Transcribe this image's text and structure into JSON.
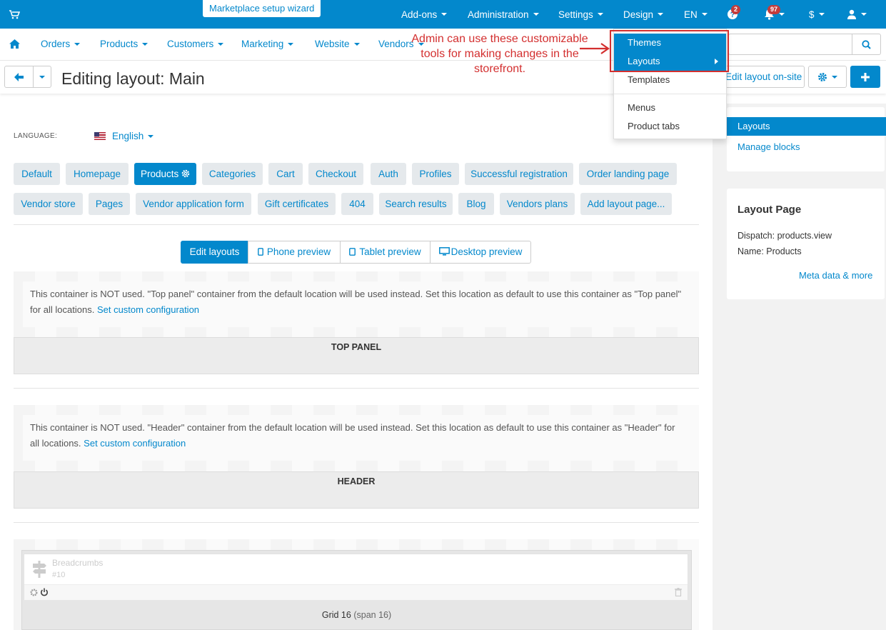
{
  "topbar": {
    "wizard": "Marketplace setup wizard",
    "items": [
      "Add-ons",
      "Administration",
      "Settings",
      "Design",
      "EN",
      "$"
    ],
    "help_badge": "2",
    "notif_badge": "97"
  },
  "nav2": {
    "items": [
      "Orders",
      "Products",
      "Customers",
      "Marketing",
      "Website",
      "Vendors"
    ]
  },
  "toolbar": {
    "title": "Editing layout: Main",
    "edit_onsite": "Edit layout on-site"
  },
  "language": {
    "label": "LANGUAGE:",
    "value": "English"
  },
  "tabs_row1": [
    "Default",
    "Homepage",
    "Products",
    "Categories",
    "Cart",
    "Checkout",
    "Auth",
    "Profiles",
    "Successful registration",
    "Order landing page"
  ],
  "tabs_row2": [
    "Vendor store",
    "Pages",
    "Vendor application form",
    "Gift certificates",
    "404",
    "Search results",
    "Blog",
    "Vendors plans",
    "Add layout page..."
  ],
  "view_buttons": [
    "Edit layouts",
    "Phone preview",
    "Tablet preview",
    "Desktop preview"
  ],
  "containers": {
    "top_panel": {
      "notice": "This container is NOT used. \"Top panel\" container from the default location will be used instead. Set this location as default to use this container as \"Top panel\" for all locations.",
      "link": "Set custom configuration",
      "label": "TOP PANEL"
    },
    "header": {
      "notice": "This container is NOT used. \"Header\" container from the default location will be used instead. Set this location as default to use this container as \"Header\" for all locations.",
      "link": "Set custom configuration",
      "label": "HEADER"
    }
  },
  "block": {
    "name": "Breadcrumbs",
    "id": "#10",
    "grid": "Grid 16",
    "span": "(span 16)"
  },
  "sidebar": {
    "nav": [
      "Layouts",
      "Manage blocks"
    ],
    "panel_title": "Layout Page",
    "dispatch": "Dispatch: products.view",
    "name": "Name: Products",
    "meta_link": "Meta data & more"
  },
  "dropdown": {
    "items": [
      "Themes",
      "Layouts",
      "Templates",
      "Menus",
      "Product tabs"
    ]
  },
  "annotation": "Admin can use these customizable tools for making changes in the storefront.",
  "colors": {
    "accent": "#0388cc",
    "annotation": "#d32f2f"
  }
}
